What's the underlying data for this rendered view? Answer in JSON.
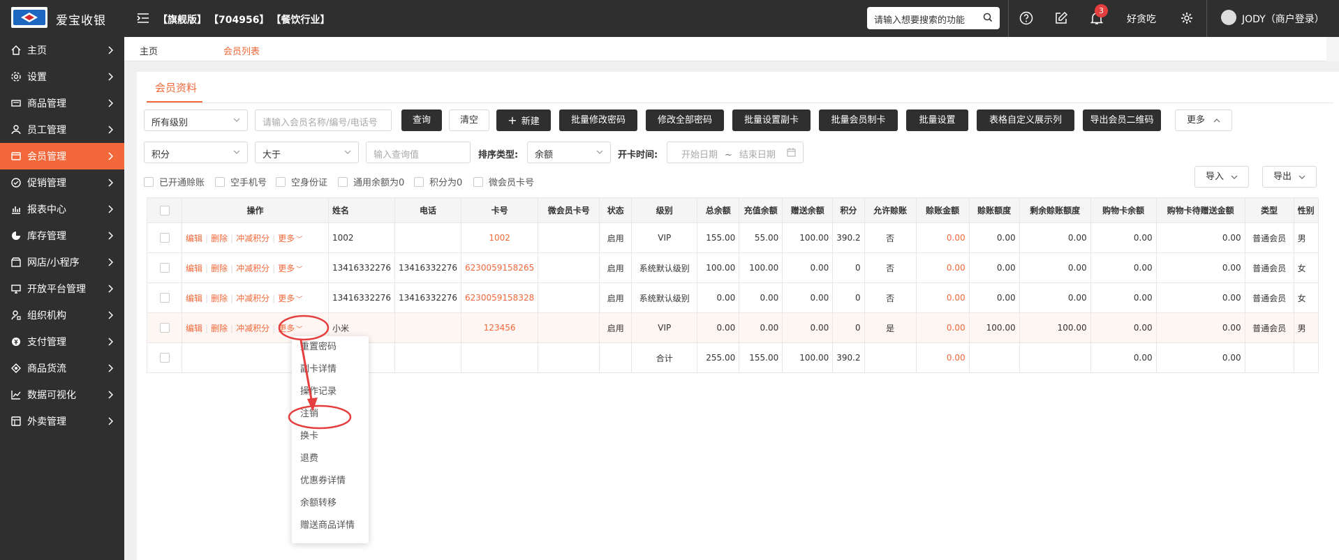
{
  "header": {
    "app_name": "爱宝收银",
    "tags": [
      "【旗舰版】",
      "【704956】",
      "【餐饮行业】"
    ],
    "search_placeholder": "请输入想要搜索的功能",
    "notification_count": "3",
    "shop_name": "好贪吃",
    "user_name": "JODY（商户登录）",
    "icons": [
      "menu-toggle-icon",
      "search-icon",
      "help-icon",
      "edit-icon",
      "bell-icon",
      "gear-icon"
    ]
  },
  "sidebar": {
    "items": [
      {
        "label": "主页",
        "icon": "home-icon"
      },
      {
        "label": "设置",
        "icon": "settings-icon"
      },
      {
        "label": "商品管理",
        "icon": "product-icon"
      },
      {
        "label": "员工管理",
        "icon": "staff-icon"
      },
      {
        "label": "会员管理",
        "icon": "member-icon",
        "active": true
      },
      {
        "label": "促销管理",
        "icon": "promo-icon"
      },
      {
        "label": "报表中心",
        "icon": "report-icon"
      },
      {
        "label": "库存管理",
        "icon": "inventory-icon"
      },
      {
        "label": "网店/小程序",
        "icon": "store-icon"
      },
      {
        "label": "开放平台管理",
        "icon": "platform-icon"
      },
      {
        "label": "组织机构",
        "icon": "org-icon"
      },
      {
        "label": "支付管理",
        "icon": "payment-icon"
      },
      {
        "label": "商品货流",
        "icon": "flow-icon"
      },
      {
        "label": "数据可视化",
        "icon": "chart-icon"
      },
      {
        "label": "外卖管理",
        "icon": "delivery-icon"
      }
    ]
  },
  "tabs": [
    {
      "label": "主页"
    },
    {
      "label": "会员列表",
      "active": true
    }
  ],
  "panel": {
    "title": "会员资料"
  },
  "filters": {
    "level_select": "所有级别",
    "keyword_placeholder": "请输入会员名称/编号/电话号",
    "query_button": "查询",
    "clear_button": "清空",
    "new_button": "新建",
    "batch_password_button": "批量修改密码",
    "all_password_button": "修改全部密码",
    "batch_sub_card_button": "批量设置副卡",
    "batch_card_button": "批量会员制卡",
    "batch_settings_button": "批量设置",
    "custom_columns_button": "表格自定义展示列",
    "export_qr_button": "导出会员二维码",
    "more_button": "更多",
    "field_select": "积分",
    "compare_select": "大于",
    "value_placeholder": "输入查询值",
    "sort_label": "排序类型:",
    "sort_select": "余额",
    "card_time_label": "开卡时间:",
    "start_date_placeholder": "开始日期",
    "date_sep": "~",
    "end_date_placeholder": "结束日期",
    "import_button": "导入",
    "export_button": "导出",
    "checkboxes": [
      "已开通赊账",
      "空手机号",
      "空身份证",
      "通用余额为0",
      "积分为0",
      "微会员卡号"
    ]
  },
  "table": {
    "headers": [
      "操作",
      "姓名",
      "电话",
      "卡号",
      "微会员卡号",
      "状态",
      "级别",
      "总余额",
      "充值余额",
      "赠送余额",
      "积分",
      "允许赊账",
      "赊账金额",
      "赊账额度",
      "剩余赊账额度",
      "购物卡余额",
      "购物卡待赠送金额",
      "类型",
      "性别"
    ],
    "op_labels": {
      "edit": "编辑",
      "delete": "删除",
      "deduct": "冲减积分",
      "more": "更多"
    },
    "rows": [
      [
        "1002",
        "",
        "1002",
        "",
        "启用",
        "VIP",
        "155.00",
        "55.00",
        "100.00",
        "390.2",
        "否",
        "0.00",
        "0.00",
        "0.00",
        "0.00",
        "0.00",
        "普通会员",
        "男"
      ],
      [
        "13416332276",
        "13416332276",
        "6230059158265",
        "",
        "启用",
        "系统默认级别",
        "100.00",
        "100.00",
        "0.00",
        "0",
        "否",
        "0.00",
        "0.00",
        "0.00",
        "0.00",
        "0.00",
        "普通会员",
        "女"
      ],
      [
        "13416332276",
        "13416332276",
        "6230059158328",
        "",
        "启用",
        "系统默认级别",
        "0.00",
        "0.00",
        "0.00",
        "0",
        "否",
        "0.00",
        "0.00",
        "0.00",
        "0.00",
        "0.00",
        "普通会员",
        "女"
      ],
      [
        "小米",
        "",
        "123456",
        "",
        "启用",
        "VIP",
        "0.00",
        "0.00",
        "0.00",
        "0",
        "是",
        "0.00",
        "100.00",
        "100.00",
        "0.00",
        "0.00",
        "普通会员",
        "男"
      ]
    ],
    "total_row": {
      "label": "合计",
      "values": [
        "255.00",
        "155.00",
        "100.00",
        "390.2",
        "",
        "0.00",
        "",
        "",
        "0.00",
        "0.00"
      ]
    }
  },
  "more_menu": {
    "items": [
      "重置密码",
      "副卡详情",
      "操作记录",
      "注销",
      "换卡",
      "退费",
      "优惠券详情",
      "余额转移",
      "赠送商品详情"
    ]
  },
  "annotation_color": "#e53e3e",
  "accent_color": "#f2683a"
}
